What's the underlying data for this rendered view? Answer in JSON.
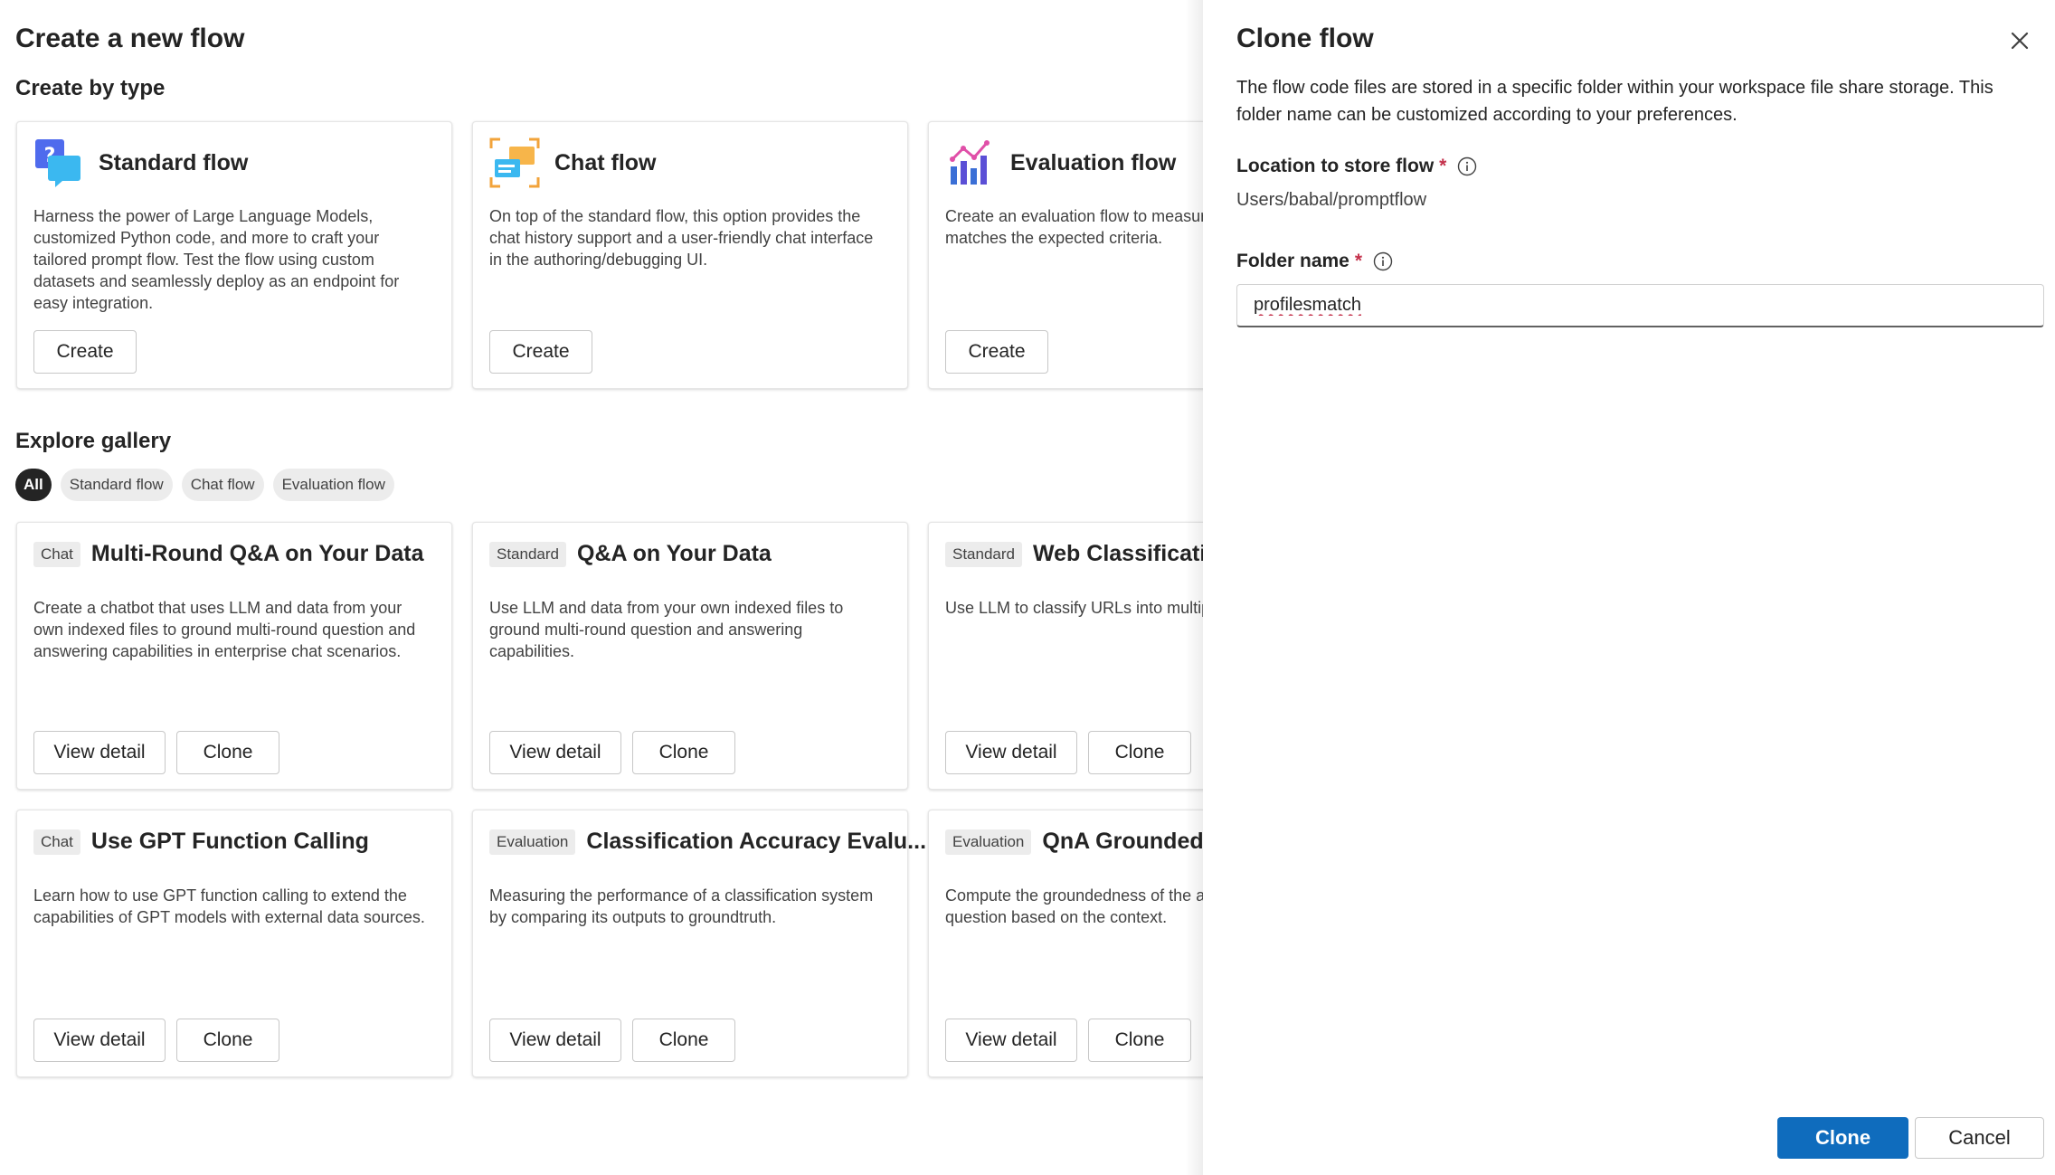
{
  "page": {
    "title": "Create a new flow",
    "create_by_type_title": "Create by type",
    "explore_gallery_title": "Explore gallery"
  },
  "flow_types": [
    {
      "icon": "standard-flow-icon",
      "title": "Standard flow",
      "description": "Harness the power of Large Language Models, customized Python code, and more to craft your tailored prompt flow. Test the flow using custom datasets and seamlessly deploy as an endpoint for easy integration.",
      "button": "Create"
    },
    {
      "icon": "chat-flow-icon",
      "title": "Chat flow",
      "description": "On top of the standard flow, this option provides the chat history support and a user-friendly chat interface in the authoring/debugging UI.",
      "button": "Create"
    },
    {
      "icon": "evaluation-flow-icon",
      "title": "Evaluation flow",
      "description": "Create an evaluation flow to measure if the output matches the expected criteria.",
      "button": "Create"
    }
  ],
  "filters": [
    "All",
    "Standard flow",
    "Chat flow",
    "Evaluation flow"
  ],
  "gallery": [
    {
      "tag": "Chat",
      "title": "Multi-Round Q&A on Your Data",
      "description": "Create a chatbot that uses LLM and data from your own indexed files to ground multi-round question and answering capabilities in enterprise chat scenarios.",
      "view": "View detail",
      "clone": "Clone"
    },
    {
      "tag": "Standard",
      "title": "Q&A on Your Data",
      "description": "Use LLM and data from your own indexed files to ground multi-round question and answering capabilities.",
      "view": "View detail",
      "clone": "Clone"
    },
    {
      "tag": "Standard",
      "title": "Web Classification",
      "description": "Use LLM to classify URLs into multiple categories.",
      "view": "View detail",
      "clone": "Clone"
    },
    {
      "tag": "Chat",
      "title": "Use GPT Function Calling",
      "description": "Learn how to use GPT function calling to extend the capabilities of GPT models with external data sources.",
      "view": "View detail",
      "clone": "Clone"
    },
    {
      "tag": "Evaluation",
      "title": "Classification Accuracy Evalu...",
      "description": "Measuring the performance of a classification system by comparing its outputs to groundtruth.",
      "view": "View detail",
      "clone": "Clone"
    },
    {
      "tag": "Evaluation",
      "title": "QnA Groundedness",
      "description": "Compute the groundedness of the answer for the given question based on the context.",
      "view": "View detail",
      "clone": "Clone"
    }
  ],
  "panel": {
    "title": "Clone flow",
    "description": "The flow code files are stored in a specific folder within your workspace file share storage. This folder name can be customized according to your preferences.",
    "location_label": "Location to store flow",
    "location_value": "Users/babal/promptflow",
    "folder_label": "Folder name",
    "folder_value": "profilesmatch",
    "required_mark": "*",
    "clone_button": "Clone",
    "cancel_button": "Cancel"
  },
  "colors": {
    "primary": "#0f6cbd",
    "required": "#c4314b",
    "tag_bg": "#ececec"
  }
}
